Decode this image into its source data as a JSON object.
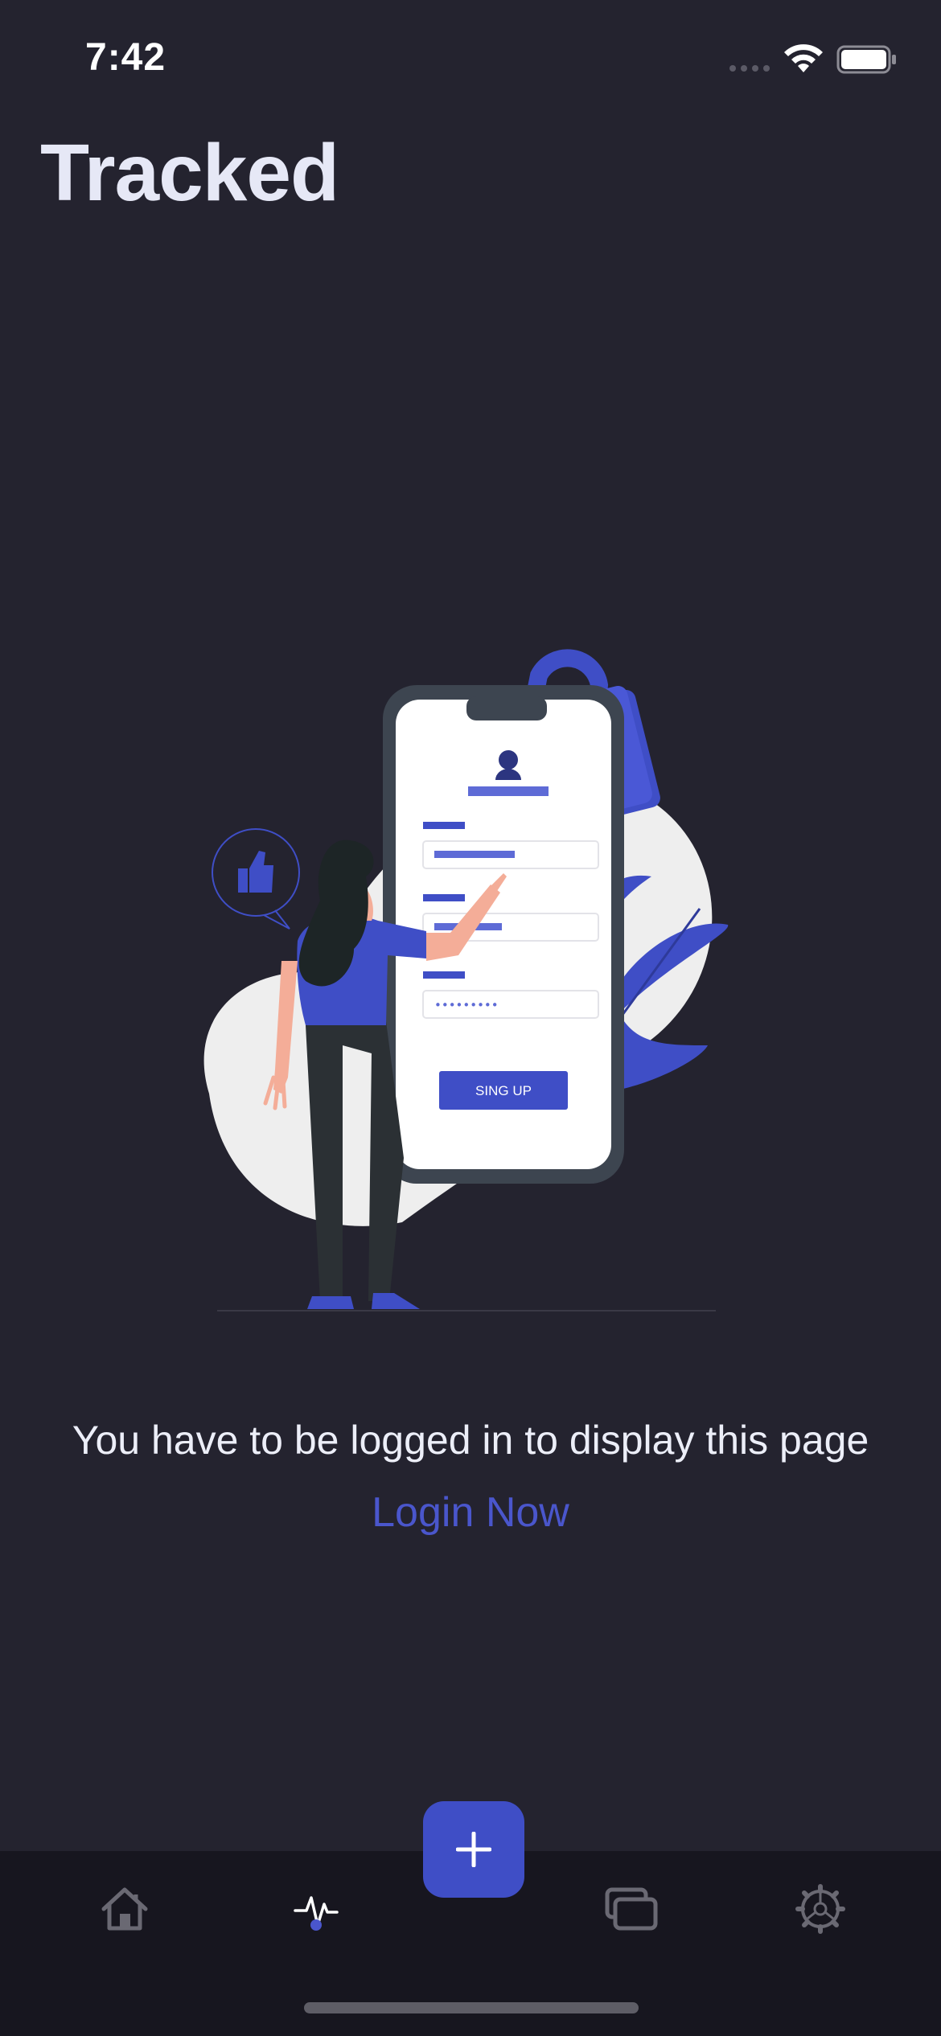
{
  "status_bar": {
    "time": "7:42"
  },
  "header": {
    "title": "Tracked"
  },
  "illustration": {
    "signup_button_label": "SING UP",
    "password_mask": "•••••••••",
    "accent_color": "#3f4ec6"
  },
  "main": {
    "message": "You have to be logged in to display this page",
    "login_link": "Login Now"
  },
  "tab_bar": {
    "tabs": [
      {
        "icon": "home-icon",
        "active": false
      },
      {
        "icon": "activity-icon",
        "active": true
      },
      {
        "icon": "cards-icon",
        "active": false
      },
      {
        "icon": "settings-icon",
        "active": false
      }
    ],
    "add_button_icon": "plus-icon"
  },
  "colors": {
    "background": "#24232f",
    "tab_bar": "#17161f",
    "accent": "#3f4ec6",
    "link": "#4a56cc"
  }
}
